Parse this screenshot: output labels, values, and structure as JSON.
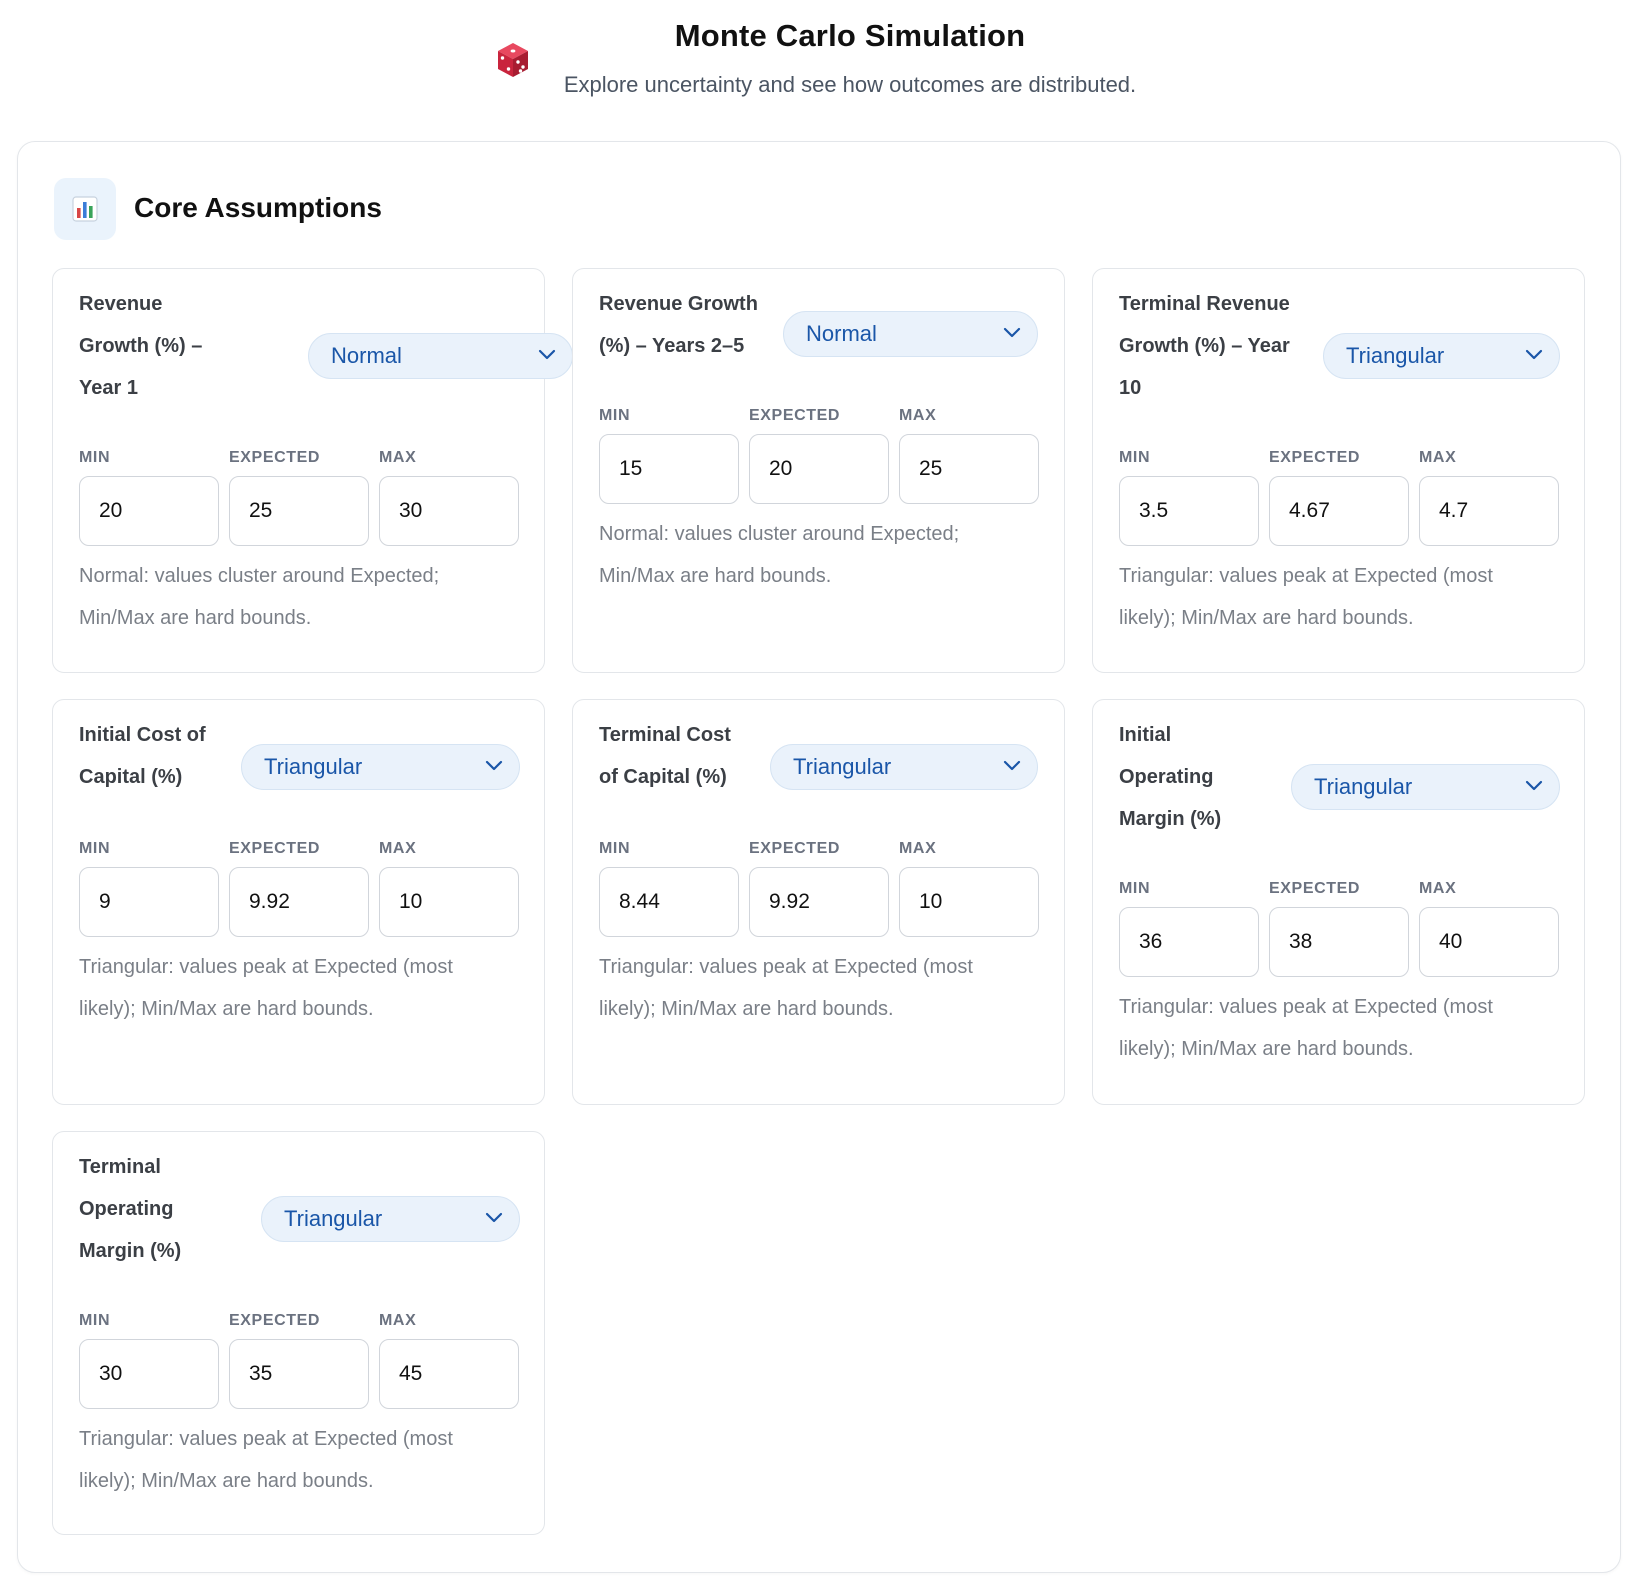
{
  "header": {
    "title": "Monte Carlo Simulation",
    "subtitle": "Explore uncertainty and see how outcomes are distributed."
  },
  "section": {
    "title": "Core Assumptions",
    "icon": "bar-chart-icon"
  },
  "columns": {
    "min": "MIN",
    "expected": "EXPECTED",
    "max": "MAX"
  },
  "cards": [
    {
      "label_lines": [
        "Revenue",
        "Growth (%) –",
        "Year 1"
      ],
      "distribution": "Normal",
      "min": "20",
      "expected": "25",
      "max": "30",
      "hint_lines": [
        "Normal: values cluster around Expected;",
        "Min/Max are hard bounds."
      ]
    },
    {
      "label_lines": [
        "Revenue Growth",
        "(%) – Years 2–5"
      ],
      "distribution": "Normal",
      "min": "15",
      "expected": "20",
      "max": "25",
      "hint_lines": [
        "Normal: values cluster around Expected;",
        "Min/Max are hard bounds."
      ]
    },
    {
      "label_lines": [
        "Terminal Revenue",
        "Growth (%) – Year",
        "10"
      ],
      "distribution": "Triangular",
      "min": "3.5",
      "expected": "4.67",
      "max": "4.7",
      "hint_lines": [
        "Triangular: values peak at Expected (most",
        "likely); Min/Max are hard bounds."
      ]
    },
    {
      "label_lines": [
        "Initial Cost of",
        "Capital (%)"
      ],
      "distribution": "Triangular",
      "min": "9",
      "expected": "9.92",
      "max": "10",
      "hint_lines": [
        "Triangular: values peak at Expected (most",
        "likely); Min/Max are hard bounds."
      ]
    },
    {
      "label_lines": [
        "Terminal Cost",
        "of Capital (%)"
      ],
      "distribution": "Triangular",
      "min": "8.44",
      "expected": "9.92",
      "max": "10",
      "hint_lines": [
        "Triangular: values peak at Expected (most",
        "likely); Min/Max are hard bounds."
      ]
    },
    {
      "label_lines": [
        "Initial",
        "Operating",
        "Margin (%)"
      ],
      "distribution": "Triangular",
      "min": "36",
      "expected": "38",
      "max": "40",
      "hint_lines": [
        "Triangular: values peak at Expected (most",
        "likely); Min/Max are hard bounds."
      ]
    },
    {
      "label_lines": [
        "Terminal",
        "Operating",
        "Margin (%)"
      ],
      "distribution": "Triangular",
      "min": "30",
      "expected": "35",
      "max": "45",
      "hint_lines": [
        "Triangular: values peak at Expected (most",
        "likely); Min/Max are hard bounds."
      ]
    }
  ]
}
